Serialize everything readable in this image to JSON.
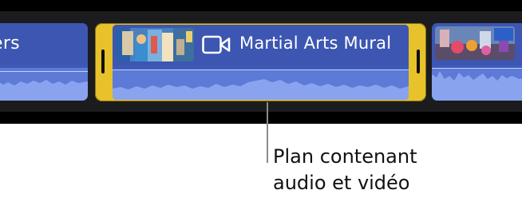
{
  "timeline": {
    "left_clip": {
      "name_fragment": "ers",
      "color": "#3d5ab8"
    },
    "selected_clip": {
      "title": "Martial Arts Mural",
      "icon": "video-camera-icon",
      "selection_color": "#e7c22b"
    },
    "right_clip": {
      "color": "#3d5ab8"
    }
  },
  "callout": {
    "line1": "Plan contenant",
    "line2": "audio et vidéo"
  }
}
